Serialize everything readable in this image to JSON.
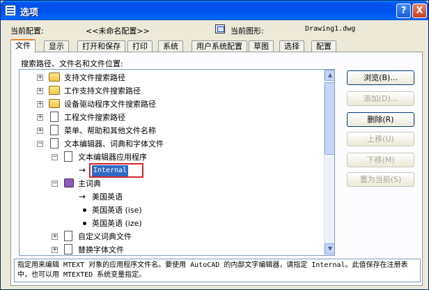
{
  "window": {
    "title": "选项",
    "help_label": "?",
    "close_label": "X"
  },
  "profile": {
    "label": "当前配置:",
    "value": "<<未命名配置>>"
  },
  "drawing": {
    "label": "当前图形:",
    "value": "Drawing1.dwg"
  },
  "tabs": [
    "文件",
    "显示",
    "打开和保存",
    "打印",
    "系统",
    "用户系统配置",
    "草图",
    "选择",
    "配置"
  ],
  "active_tab": 0,
  "panel_label": "搜索路径、文件名和文件位置:",
  "tree": {
    "items": [
      {
        "label": "支持文件搜索路径"
      },
      {
        "label": "工作支持文件搜索路径"
      },
      {
        "label": "设备驱动程序文件搜索路径"
      },
      {
        "label": "工程文件搜索路径"
      },
      {
        "label": "菜单、帮助和其他文件名称"
      },
      {
        "label": "文本编辑器、词典和字体文件"
      },
      {
        "label": "文本编辑器应用程序"
      },
      {
        "label": "Internal"
      },
      {
        "label": "主词典"
      },
      {
        "label": "美国英语"
      },
      {
        "label": "英国英语 (ise)"
      },
      {
        "label": "英国英语 (ize)"
      },
      {
        "label": "自定义词典文件"
      },
      {
        "label": "替换字体文件"
      }
    ]
  },
  "buttons": {
    "browse": "浏览(B)...",
    "add": "添加(D)...",
    "remove": "删除(R)",
    "move_up": "上移(U)",
    "move_down": "下移(M)",
    "set_current": "置为当前(S)"
  },
  "description": "指定用来编辑 MTEXT 对象的应用程序文件名。要使用 AutoCAD 的内部文字编辑器，请指定 Internal。此值保存在注册表中，也可以用 MTEXTED 系统变量指定。",
  "colors": {
    "title_bar": "#0053ee",
    "selection": "#316ac5",
    "highlight_box": "#d0262a",
    "active_tab_accent": "#e68b2c"
  }
}
